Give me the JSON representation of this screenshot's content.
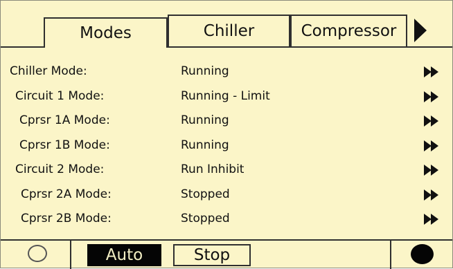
{
  "tabs": {
    "modes": "Modes",
    "chiller": "Chiller",
    "compressor": "Compressor"
  },
  "rows": [
    {
      "label": "Chiller Mode:",
      "value": "Running"
    },
    {
      "label": "Circuit 1 Mode:",
      "value": "Running - Limit"
    },
    {
      "label": "Cprsr 1A Mode:",
      "value": "Running"
    },
    {
      "label": "Cprsr 1B Mode:",
      "value": "Running"
    },
    {
      "label": "Circuit 2 Mode:",
      "value": "Run Inhibit"
    },
    {
      "label": "Cprsr 2A Mode:",
      "value": "Stopped"
    },
    {
      "label": "Cprsr 2B Mode:",
      "value": "Stopped"
    }
  ],
  "bottom": {
    "auto_label": "Auto",
    "stop_label": "Stop"
  },
  "colors": {
    "background": "#fbf5c8",
    "ink": "#111111",
    "selected_button_bg": "#050505",
    "selected_button_text": "#f3efc4"
  },
  "icons": {
    "next_tab": "right-triangle-icon",
    "row_detail": "double-right-arrow-icon",
    "left_softkey": "hollow-circle-icon",
    "right_softkey": "filled-circle-icon"
  }
}
